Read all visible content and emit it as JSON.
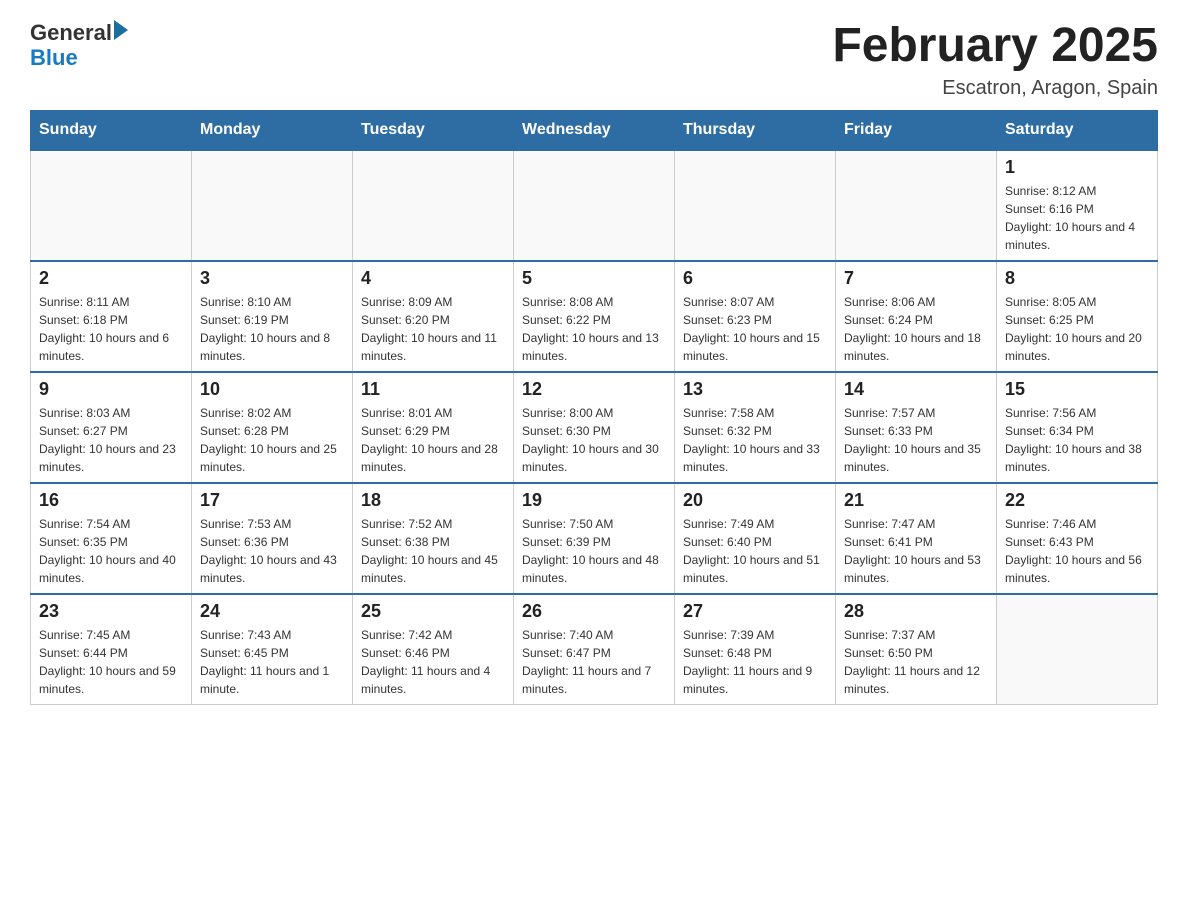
{
  "header": {
    "logo_text_general": "General",
    "logo_text_blue": "Blue",
    "month_title": "February 2025",
    "location": "Escatron, Aragon, Spain"
  },
  "days_of_week": [
    "Sunday",
    "Monday",
    "Tuesday",
    "Wednesday",
    "Thursday",
    "Friday",
    "Saturday"
  ],
  "weeks": [
    [
      {
        "day": "",
        "sunrise": "",
        "sunset": "",
        "daylight": ""
      },
      {
        "day": "",
        "sunrise": "",
        "sunset": "",
        "daylight": ""
      },
      {
        "day": "",
        "sunrise": "",
        "sunset": "",
        "daylight": ""
      },
      {
        "day": "",
        "sunrise": "",
        "sunset": "",
        "daylight": ""
      },
      {
        "day": "",
        "sunrise": "",
        "sunset": "",
        "daylight": ""
      },
      {
        "day": "",
        "sunrise": "",
        "sunset": "",
        "daylight": ""
      },
      {
        "day": "1",
        "sunrise": "Sunrise: 8:12 AM",
        "sunset": "Sunset: 6:16 PM",
        "daylight": "Daylight: 10 hours and 4 minutes."
      }
    ],
    [
      {
        "day": "2",
        "sunrise": "Sunrise: 8:11 AM",
        "sunset": "Sunset: 6:18 PM",
        "daylight": "Daylight: 10 hours and 6 minutes."
      },
      {
        "day": "3",
        "sunrise": "Sunrise: 8:10 AM",
        "sunset": "Sunset: 6:19 PM",
        "daylight": "Daylight: 10 hours and 8 minutes."
      },
      {
        "day": "4",
        "sunrise": "Sunrise: 8:09 AM",
        "sunset": "Sunset: 6:20 PM",
        "daylight": "Daylight: 10 hours and 11 minutes."
      },
      {
        "day": "5",
        "sunrise": "Sunrise: 8:08 AM",
        "sunset": "Sunset: 6:22 PM",
        "daylight": "Daylight: 10 hours and 13 minutes."
      },
      {
        "day": "6",
        "sunrise": "Sunrise: 8:07 AM",
        "sunset": "Sunset: 6:23 PM",
        "daylight": "Daylight: 10 hours and 15 minutes."
      },
      {
        "day": "7",
        "sunrise": "Sunrise: 8:06 AM",
        "sunset": "Sunset: 6:24 PM",
        "daylight": "Daylight: 10 hours and 18 minutes."
      },
      {
        "day": "8",
        "sunrise": "Sunrise: 8:05 AM",
        "sunset": "Sunset: 6:25 PM",
        "daylight": "Daylight: 10 hours and 20 minutes."
      }
    ],
    [
      {
        "day": "9",
        "sunrise": "Sunrise: 8:03 AM",
        "sunset": "Sunset: 6:27 PM",
        "daylight": "Daylight: 10 hours and 23 minutes."
      },
      {
        "day": "10",
        "sunrise": "Sunrise: 8:02 AM",
        "sunset": "Sunset: 6:28 PM",
        "daylight": "Daylight: 10 hours and 25 minutes."
      },
      {
        "day": "11",
        "sunrise": "Sunrise: 8:01 AM",
        "sunset": "Sunset: 6:29 PM",
        "daylight": "Daylight: 10 hours and 28 minutes."
      },
      {
        "day": "12",
        "sunrise": "Sunrise: 8:00 AM",
        "sunset": "Sunset: 6:30 PM",
        "daylight": "Daylight: 10 hours and 30 minutes."
      },
      {
        "day": "13",
        "sunrise": "Sunrise: 7:58 AM",
        "sunset": "Sunset: 6:32 PM",
        "daylight": "Daylight: 10 hours and 33 minutes."
      },
      {
        "day": "14",
        "sunrise": "Sunrise: 7:57 AM",
        "sunset": "Sunset: 6:33 PM",
        "daylight": "Daylight: 10 hours and 35 minutes."
      },
      {
        "day": "15",
        "sunrise": "Sunrise: 7:56 AM",
        "sunset": "Sunset: 6:34 PM",
        "daylight": "Daylight: 10 hours and 38 minutes."
      }
    ],
    [
      {
        "day": "16",
        "sunrise": "Sunrise: 7:54 AM",
        "sunset": "Sunset: 6:35 PM",
        "daylight": "Daylight: 10 hours and 40 minutes."
      },
      {
        "day": "17",
        "sunrise": "Sunrise: 7:53 AM",
        "sunset": "Sunset: 6:36 PM",
        "daylight": "Daylight: 10 hours and 43 minutes."
      },
      {
        "day": "18",
        "sunrise": "Sunrise: 7:52 AM",
        "sunset": "Sunset: 6:38 PM",
        "daylight": "Daylight: 10 hours and 45 minutes."
      },
      {
        "day": "19",
        "sunrise": "Sunrise: 7:50 AM",
        "sunset": "Sunset: 6:39 PM",
        "daylight": "Daylight: 10 hours and 48 minutes."
      },
      {
        "day": "20",
        "sunrise": "Sunrise: 7:49 AM",
        "sunset": "Sunset: 6:40 PM",
        "daylight": "Daylight: 10 hours and 51 minutes."
      },
      {
        "day": "21",
        "sunrise": "Sunrise: 7:47 AM",
        "sunset": "Sunset: 6:41 PM",
        "daylight": "Daylight: 10 hours and 53 minutes."
      },
      {
        "day": "22",
        "sunrise": "Sunrise: 7:46 AM",
        "sunset": "Sunset: 6:43 PM",
        "daylight": "Daylight: 10 hours and 56 minutes."
      }
    ],
    [
      {
        "day": "23",
        "sunrise": "Sunrise: 7:45 AM",
        "sunset": "Sunset: 6:44 PM",
        "daylight": "Daylight: 10 hours and 59 minutes."
      },
      {
        "day": "24",
        "sunrise": "Sunrise: 7:43 AM",
        "sunset": "Sunset: 6:45 PM",
        "daylight": "Daylight: 11 hours and 1 minute."
      },
      {
        "day": "25",
        "sunrise": "Sunrise: 7:42 AM",
        "sunset": "Sunset: 6:46 PM",
        "daylight": "Daylight: 11 hours and 4 minutes."
      },
      {
        "day": "26",
        "sunrise": "Sunrise: 7:40 AM",
        "sunset": "Sunset: 6:47 PM",
        "daylight": "Daylight: 11 hours and 7 minutes."
      },
      {
        "day": "27",
        "sunrise": "Sunrise: 7:39 AM",
        "sunset": "Sunset: 6:48 PM",
        "daylight": "Daylight: 11 hours and 9 minutes."
      },
      {
        "day": "28",
        "sunrise": "Sunrise: 7:37 AM",
        "sunset": "Sunset: 6:50 PM",
        "daylight": "Daylight: 11 hours and 12 minutes."
      },
      {
        "day": "",
        "sunrise": "",
        "sunset": "",
        "daylight": ""
      }
    ]
  ]
}
